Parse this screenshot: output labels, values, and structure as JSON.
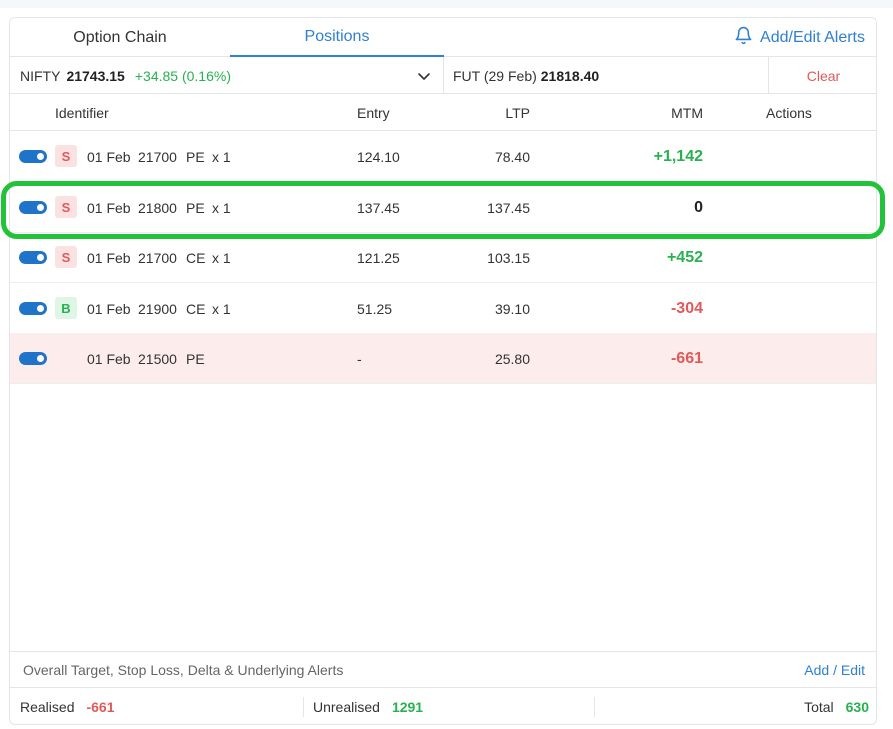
{
  "tabs": [
    {
      "label": "Option Chain",
      "active": false
    },
    {
      "label": "Positions",
      "active": true
    }
  ],
  "alerts_link": {
    "label": "Add/Edit Alerts",
    "icon": "bell-icon"
  },
  "instrument": {
    "symbol": "NIFTY",
    "ltp": "21743.15",
    "change": "+34.85 (0.16%)",
    "future_label": "FUT (29 Feb)",
    "future_price": "21818.40",
    "clear_label": "Clear"
  },
  "table": {
    "headers": {
      "identifier": "Identifier",
      "entry": "Entry",
      "ltp": "LTP",
      "mtm": "MTM",
      "actions": "Actions"
    },
    "rows": [
      {
        "side": "S",
        "date": "01 Feb",
        "strike": "21700",
        "type": "PE",
        "qty": "x 1",
        "entry": "124.10",
        "ltp": "78.40",
        "mtm": "+1,142",
        "mtm_sign": "pos",
        "closed": false
      },
      {
        "side": "S",
        "date": "01 Feb",
        "strike": "21800",
        "type": "PE",
        "qty": "x 1",
        "entry": "137.45",
        "ltp": "137.45",
        "mtm": "0",
        "mtm_sign": "zero",
        "closed": false
      },
      {
        "side": "S",
        "date": "01 Feb",
        "strike": "21700",
        "type": "CE",
        "qty": "x 1",
        "entry": "121.25",
        "ltp": "103.15",
        "mtm": "+452",
        "mtm_sign": "pos",
        "closed": false
      },
      {
        "side": "B",
        "date": "01 Feb",
        "strike": "21900",
        "type": "CE",
        "qty": "x 1",
        "entry": "51.25",
        "ltp": "39.10",
        "mtm": "-304",
        "mtm_sign": "neg",
        "closed": false
      },
      {
        "side": "",
        "date": "01 Feb",
        "strike": "21500",
        "type": "PE",
        "qty": "",
        "entry": "-",
        "ltp": "25.80",
        "mtm": "-661",
        "mtm_sign": "neg",
        "closed": true
      }
    ]
  },
  "overall_alerts": {
    "label": "Overall Target, Stop Loss, Delta & Underlying Alerts",
    "edit_label": "Add / Edit"
  },
  "summary": {
    "realised_label": "Realised",
    "realised_value": "-661",
    "unrealised_label": "Unrealised",
    "unrealised_value": "1291",
    "total_label": "Total",
    "total_value": "630"
  },
  "colors": {
    "accent": "#2f80d0",
    "positive": "#27b14f",
    "negative": "#e05a5a",
    "highlight": "#22c33a",
    "toggle": "#1f74c9"
  }
}
